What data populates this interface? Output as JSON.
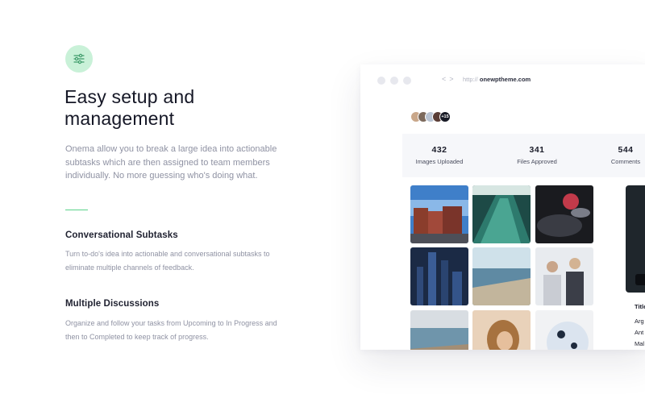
{
  "feature": {
    "icon": "sliders-icon",
    "heading_line1": "Easy setup and",
    "heading_line2": "management",
    "intro": "Onema allow you to break a large idea into actionable subtasks which are then assigned to team members individually. No more guessing who's doing what.",
    "accent_color": "#5bd38a"
  },
  "subsections": [
    {
      "title": "Conversational Subtasks",
      "body": "Turn to-do's idea into actionable and conversational subtasks to eliminate multiple channels of feedback."
    },
    {
      "title": "Multiple Discussions",
      "body": "Organize and follow your tasks from Upcoming to In Progress and then to Completed to keep track of progress."
    }
  ],
  "browser": {
    "url_prefix": "http://",
    "url_domain": "onewptheme.com",
    "avatars_more": "+15",
    "stats": [
      {
        "value": "432",
        "label": "Images Uploaded"
      },
      {
        "value": "341",
        "label": "Files Approved"
      },
      {
        "value": "544",
        "label": "Comments"
      }
    ],
    "gallery": [
      "street-buildings-photo",
      "escalator-photo",
      "car-tail-light-photo",
      "city-night-skyline-photo",
      "ocean-shore-photo",
      "two-women-photo",
      "coastline-photo",
      "woman-portrait-photo",
      "glass-bowl-photo"
    ],
    "side_title": "Title",
    "side_items": [
      "Arg",
      "Ant",
      "Mal"
    ]
  }
}
